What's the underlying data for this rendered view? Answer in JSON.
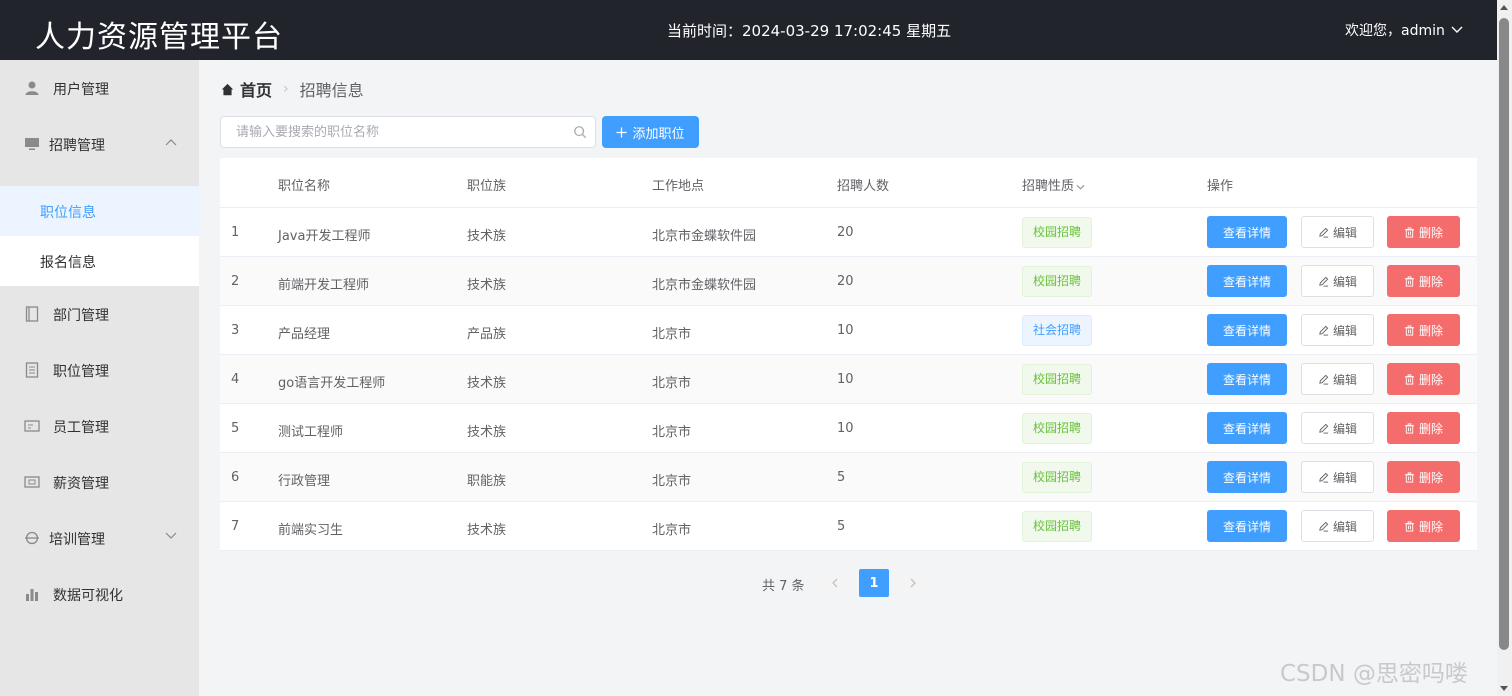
{
  "header": {
    "title": "人力资源管理平台",
    "clock": "当前时间：2024-03-29 17:02:45 星期五",
    "user": "欢迎您，admin"
  },
  "sidebar": {
    "items": [
      {
        "label": "用户管理",
        "icon": "user-icon"
      },
      {
        "label": "招聘管理",
        "icon": "monitor-icon",
        "expanded": true,
        "children": [
          {
            "label": "职位信息",
            "active": true
          },
          {
            "label": "报名信息",
            "active": false
          }
        ]
      },
      {
        "label": "部门管理",
        "icon": "notebook-icon"
      },
      {
        "label": "职位管理",
        "icon": "document-icon"
      },
      {
        "label": "员工管理",
        "icon": "id-card-icon"
      },
      {
        "label": "薪资管理",
        "icon": "wallet-icon"
      },
      {
        "label": "培训管理",
        "icon": "training-icon",
        "expanded": false
      },
      {
        "label": "数据可视化",
        "icon": "bar-chart-icon"
      }
    ]
  },
  "breadcrumb": {
    "home": "首页",
    "current": "招聘信息"
  },
  "toolbar": {
    "search_placeholder": "请输入要搜索的职位名称",
    "add_label": "添加职位"
  },
  "table": {
    "columns": [
      "职位名称",
      "职位族",
      "工作地点",
      "招聘人数",
      "招聘性质",
      "操作"
    ],
    "rows": [
      {
        "index": "1",
        "name": "Java开发工程师",
        "family": "技术族",
        "location": "北京市金蝶软件园",
        "count": "20",
        "type": "校园招聘",
        "type_color": "green"
      },
      {
        "index": "2",
        "name": "前端开发工程师",
        "family": "技术族",
        "location": "北京市金蝶软件园",
        "count": "20",
        "type": "校园招聘",
        "type_color": "green"
      },
      {
        "index": "3",
        "name": "产品经理",
        "family": "产品族",
        "location": "北京市",
        "count": "10",
        "type": "社会招聘",
        "type_color": "blue"
      },
      {
        "index": "4",
        "name": "go语言开发工程师",
        "family": "技术族",
        "location": "北京市",
        "count": "10",
        "type": "校园招聘",
        "type_color": "green"
      },
      {
        "index": "5",
        "name": "测试工程师",
        "family": "技术族",
        "location": "北京市",
        "count": "10",
        "type": "校园招聘",
        "type_color": "green"
      },
      {
        "index": "6",
        "name": "行政管理",
        "family": "职能族",
        "location": "北京市",
        "count": "5",
        "type": "校园招聘",
        "type_color": "green"
      },
      {
        "index": "7",
        "name": "前端实习生",
        "family": "技术族",
        "location": "北京市",
        "count": "5",
        "type": "校园招聘",
        "type_color": "green"
      }
    ],
    "actions": {
      "detail": "查看详情",
      "edit": "编辑",
      "delete": "删除"
    }
  },
  "pagination": {
    "total_text": "共 7 条",
    "current_page": "1"
  },
  "watermark": "CSDN @思密吗喽",
  "colors": {
    "header_bg": "#22242c",
    "primary": "#409eff",
    "danger": "#f56c6c",
    "success": "#67c23a"
  }
}
